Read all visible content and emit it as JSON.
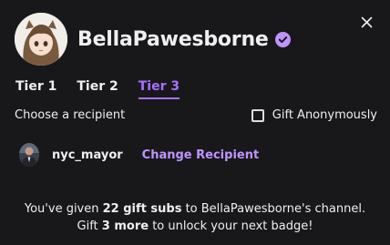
{
  "channel": {
    "name": "BellaPawesborne",
    "verified_icon": "verified-badge-icon",
    "accent_color": "#a970ff"
  },
  "close_icon": "close-icon",
  "tabs": [
    {
      "label": "Tier 1",
      "active": false
    },
    {
      "label": "Tier 2",
      "active": false
    },
    {
      "label": "Tier 3",
      "active": true
    }
  ],
  "recipient": {
    "prompt": "Choose a recipient",
    "anonymous_label": "Gift Anonymously",
    "anonymous_checked": false,
    "username": "nyc_mayor",
    "change_label": "Change Recipient"
  },
  "message": {
    "line1_prefix": "You've given ",
    "gift_count": "22 gift subs",
    "line1_suffix": " to BellaPawesborne's channel.",
    "line2_prefix": "Gift ",
    "more_count": "3 more",
    "line2_suffix": " to unlock your next badge!"
  }
}
